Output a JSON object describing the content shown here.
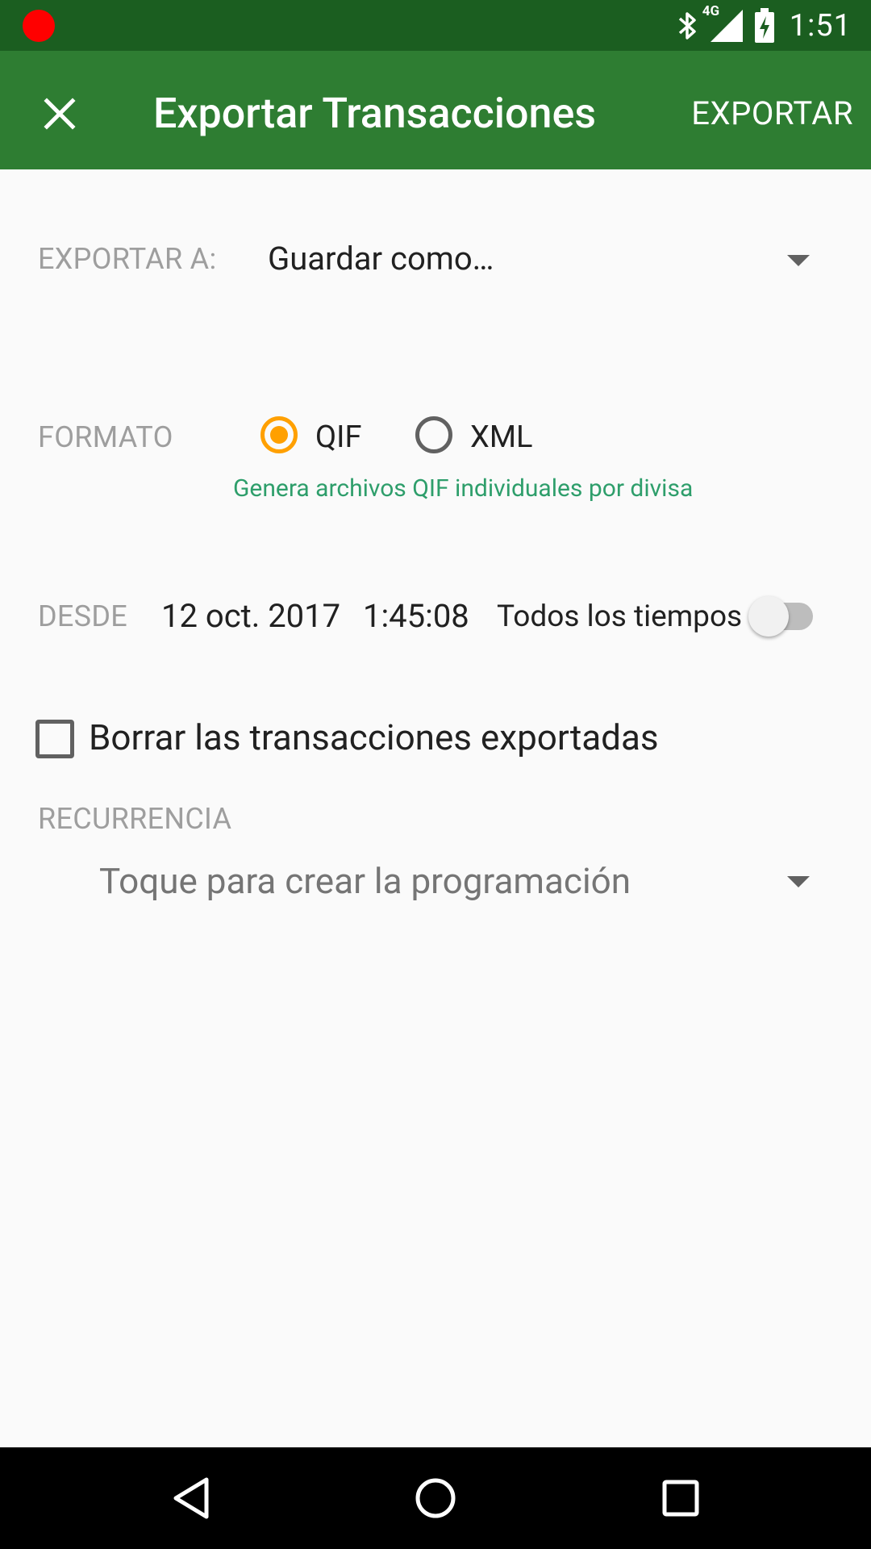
{
  "status_bar": {
    "time": "1:51",
    "network": "4G",
    "icons": [
      "recording-dot",
      "bluetooth-icon",
      "signal-icon",
      "battery-icon"
    ]
  },
  "app_bar": {
    "title": "Exportar Transacciones",
    "action_label": "EXPORTAR",
    "close_icon": "close-icon"
  },
  "export_to": {
    "label": "EXPORTAR A:",
    "selected": "Guardar como…"
  },
  "format": {
    "label": "FORMATO",
    "options": [
      {
        "label": "QIF",
        "checked": true
      },
      {
        "label": "XML",
        "checked": false
      }
    ],
    "hint": "Genera archivos QIF individuales por divisa"
  },
  "since": {
    "label": "DESDE",
    "date": "12 oct. 2017",
    "time": "1:45:08",
    "all_time_label": "Todos los tiempos",
    "all_time_enabled": false
  },
  "delete_exported": {
    "label": "Borrar las transacciones exportadas",
    "checked": false
  },
  "recurrence": {
    "label": "RECURRENCIA",
    "placeholder": "Toque para crear la programación"
  },
  "colors": {
    "status_bar": "#1B5E20",
    "app_bar": "#2E7D32",
    "accent": "#FFA000",
    "hint": "#2E9E6B"
  }
}
